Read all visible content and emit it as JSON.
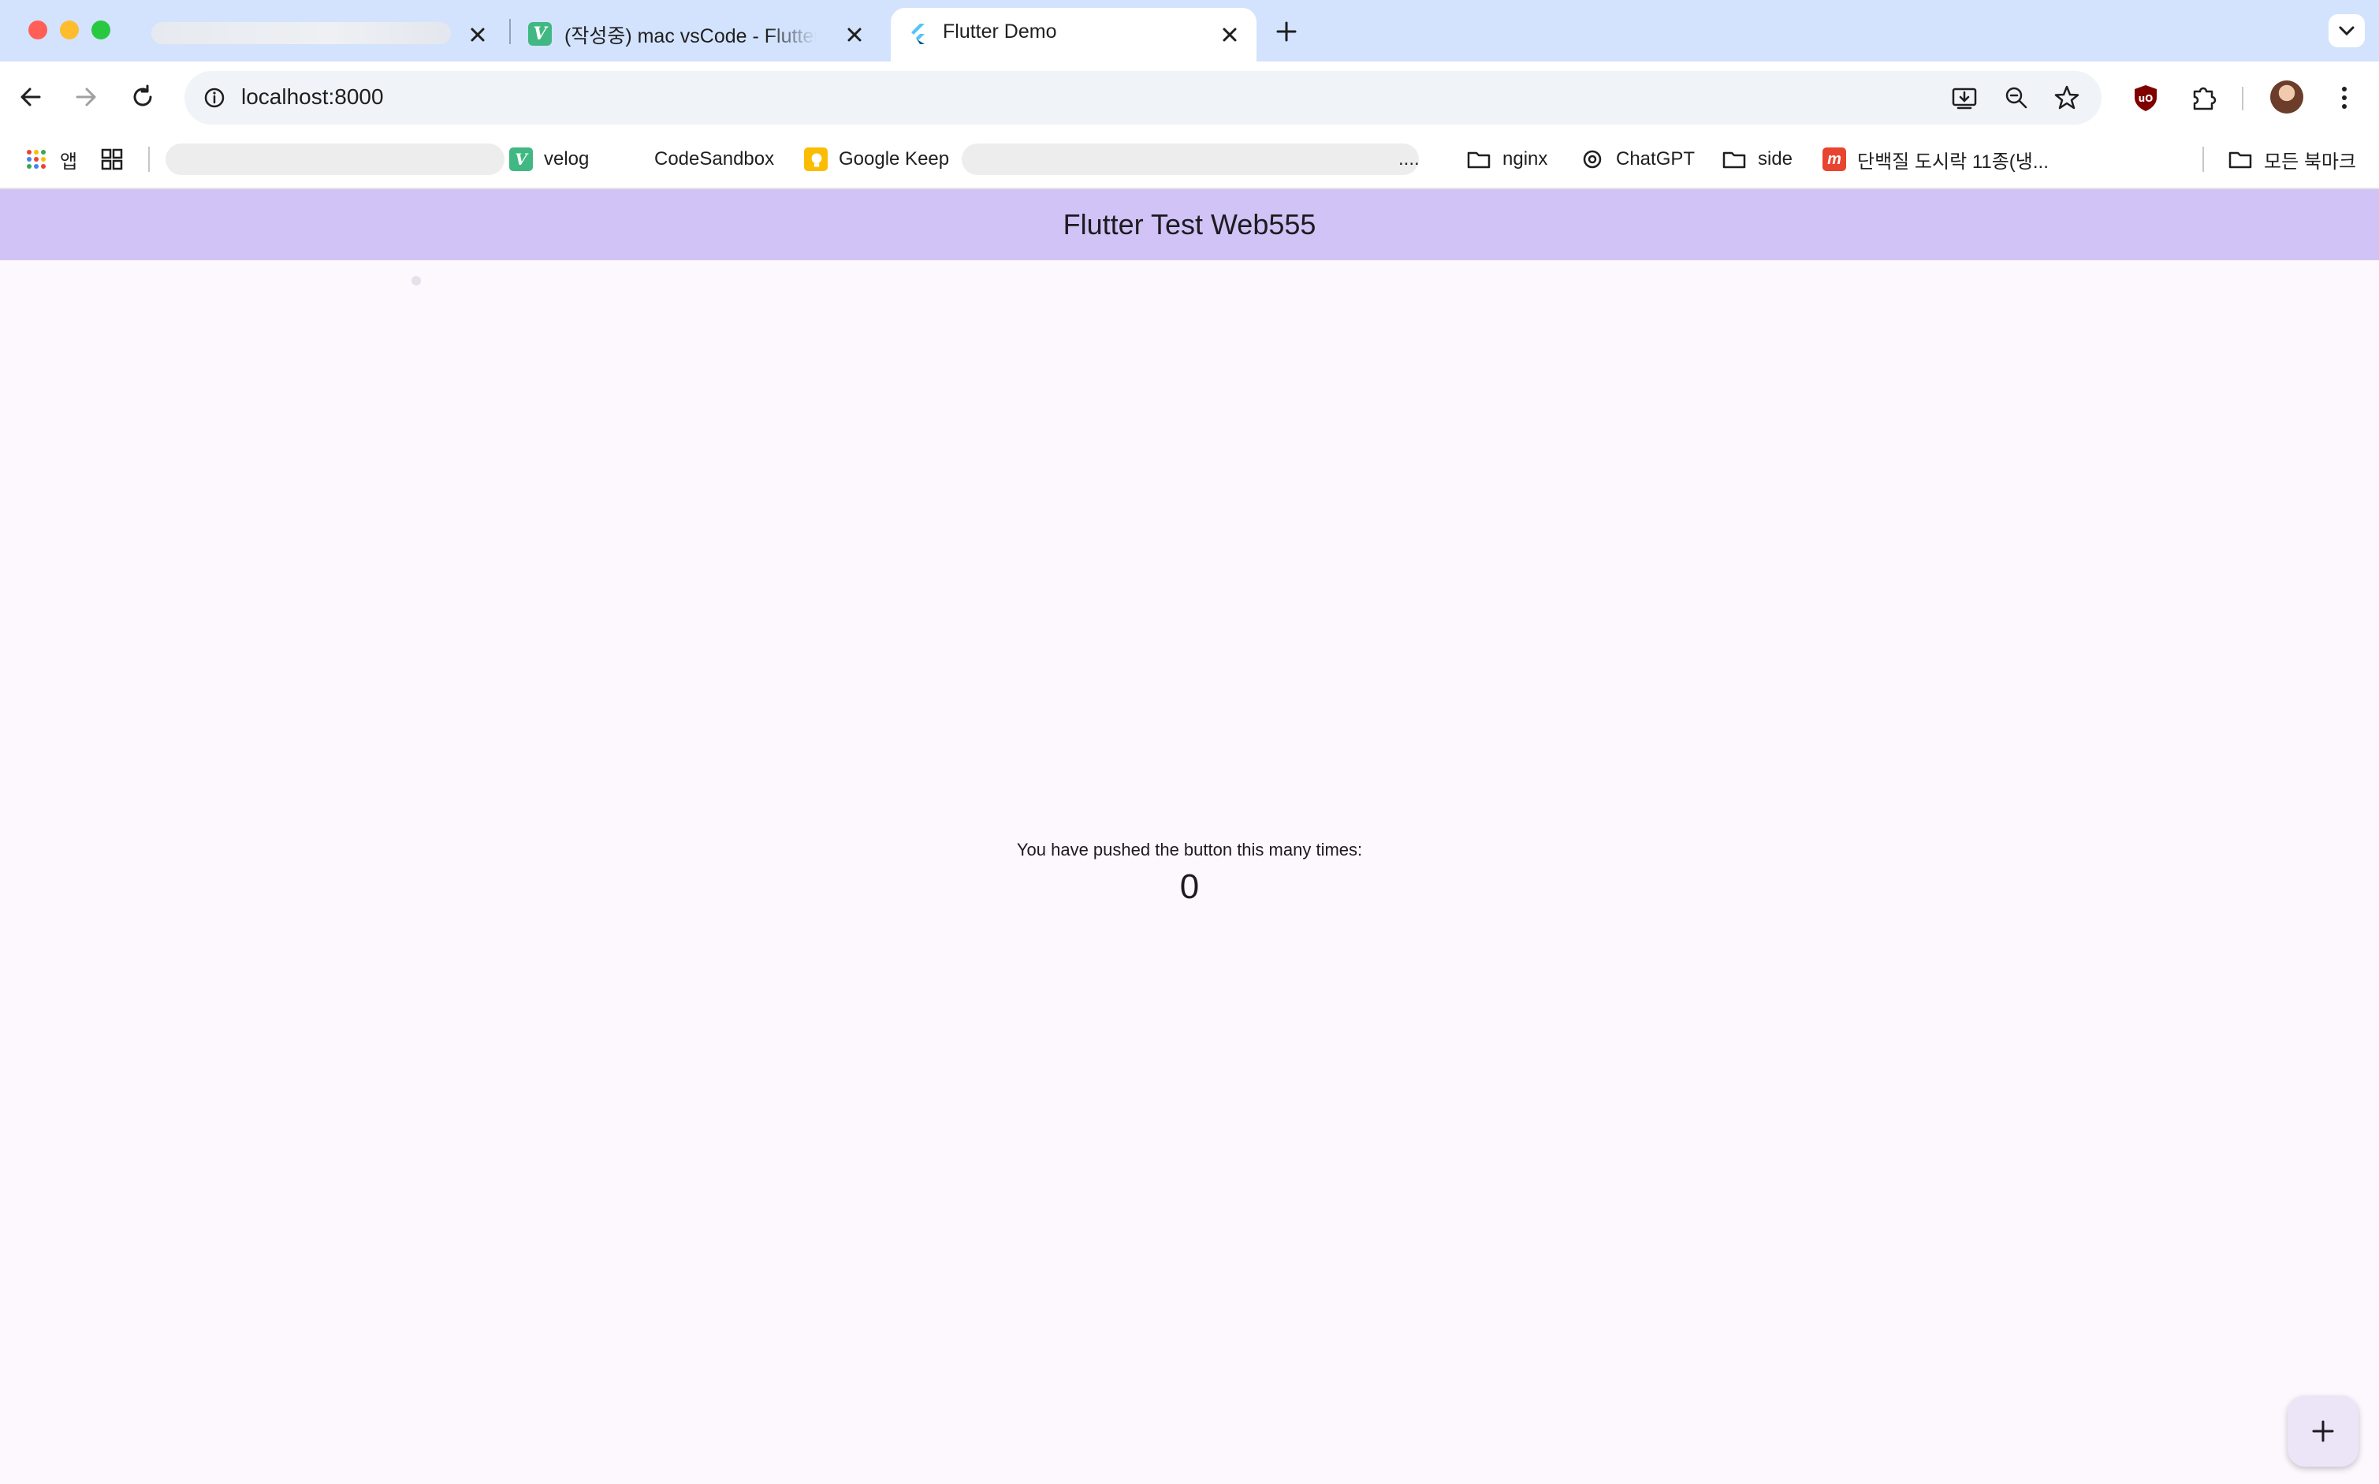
{
  "browser": {
    "tabs": [
      {
        "title": "",
        "redacted": true
      },
      {
        "title": "(작성중) mac vsCode - Flutter",
        "favicon": "velog-v-icon"
      },
      {
        "title": "Flutter Demo",
        "favicon": "flutter-icon",
        "active": true
      }
    ],
    "address_bar": {
      "url": "localhost:8000"
    },
    "bookmarks": [
      {
        "label": "앱",
        "icon": "apps-grid-icon"
      },
      {
        "label": "velog",
        "icon": "velog-icon"
      },
      {
        "label": "CodeSandbox",
        "icon": "codesandbox-icon"
      },
      {
        "label": "Google Keep",
        "icon": "google-keep-icon"
      },
      {
        "label": "....",
        "icon": ""
      },
      {
        "label": "nginx",
        "icon": "folder-icon"
      },
      {
        "label": "ChatGPT",
        "icon": "chatgpt-icon"
      },
      {
        "label": "side",
        "icon": "folder-icon"
      },
      {
        "label": "단백질 도시락 11종(냉...",
        "icon": "shop-icon"
      }
    ],
    "all_bookmarks": {
      "label": "모든 북마크",
      "icon": "folder-icon"
    },
    "colors": {
      "tabstrip": "#d3e3fd",
      "toolbar": "#ffffff",
      "omnibox": "#f0f4f9"
    }
  },
  "app": {
    "appbar_title": "Flutter Test Web555",
    "counter_label": "You have pushed the button this many times:",
    "counter_value": "0",
    "fab_icon": "add-icon",
    "colors": {
      "appbar": "#d1c3f6",
      "background": "#fdf7fe",
      "fab": "#ece4f7"
    }
  }
}
